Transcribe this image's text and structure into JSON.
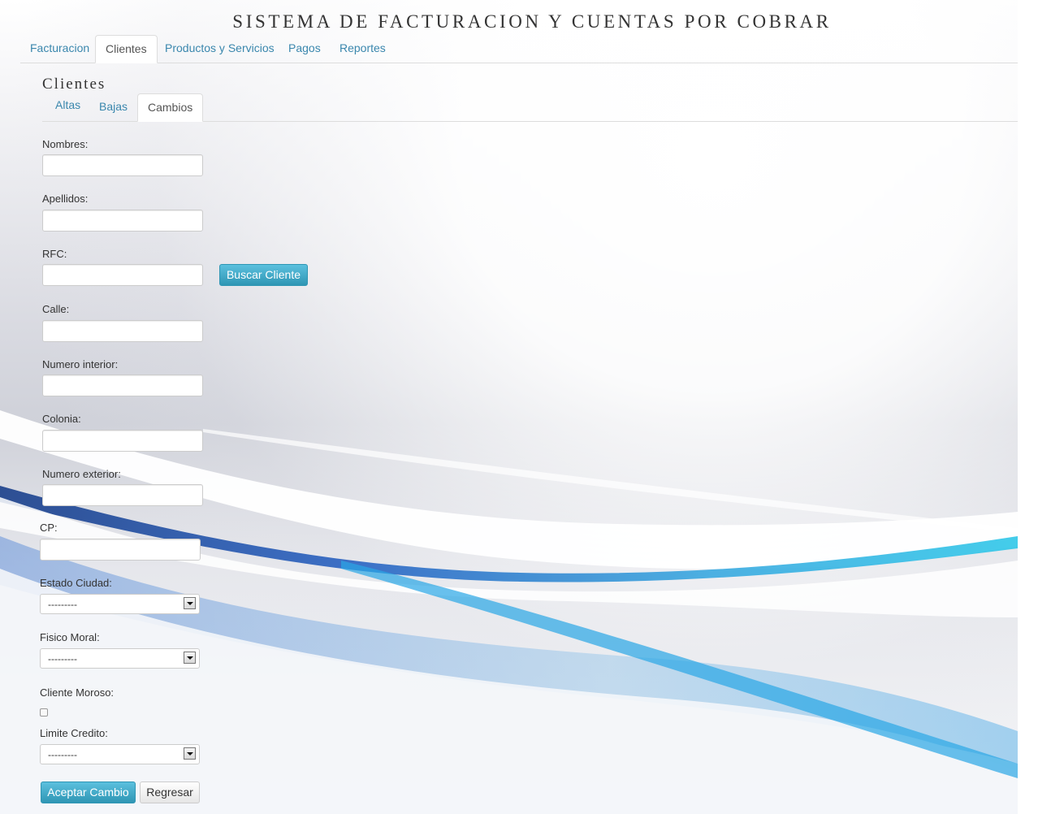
{
  "header": {
    "title": "SISTEMA DE FACTURACION Y CUENTAS POR COBRAR"
  },
  "nav": {
    "tabs": [
      {
        "label": "Facturacion"
      },
      {
        "label": "Clientes"
      },
      {
        "label": "Productos y Servicios"
      },
      {
        "label": "Pagos"
      },
      {
        "label": "Reportes"
      }
    ],
    "active": "Clientes"
  },
  "section": {
    "title": "Clientes",
    "tabs": [
      {
        "label": "Altas"
      },
      {
        "label": "Bajas"
      },
      {
        "label": "Cambios"
      }
    ],
    "active": "Cambios"
  },
  "form": {
    "nombres_label": "Nombres:",
    "nombres_value": "",
    "apellidos_label": "Apellidos:",
    "apellidos_value": "",
    "rfc_label": "RFC:",
    "rfc_value": "",
    "buscar_label": "Buscar Cliente",
    "calle_label": "Calle:",
    "calle_value": "",
    "num_interior_label": "Numero interior:",
    "num_interior_value": "",
    "colonia_label": "Colonia:",
    "colonia_value": "",
    "num_exterior_label": "Numero exterior:",
    "num_exterior_value": "",
    "cp_label": "CP:",
    "cp_value": "",
    "estado_ciudad_label": "Estado Ciudad:",
    "estado_ciudad_value": "---------",
    "fisico_moral_label": "Fisico Moral:",
    "fisico_moral_value": "---------",
    "cliente_moroso_label": "Cliente Moroso:",
    "cliente_moroso_checked": false,
    "limite_credito_label": "Limite Credito:",
    "limite_credito_value": "---------",
    "aceptar_label": "Aceptar Cambio",
    "regresar_label": "Regresar"
  },
  "colors": {
    "accent": "#2f96b4",
    "link": "#3a87ad"
  }
}
